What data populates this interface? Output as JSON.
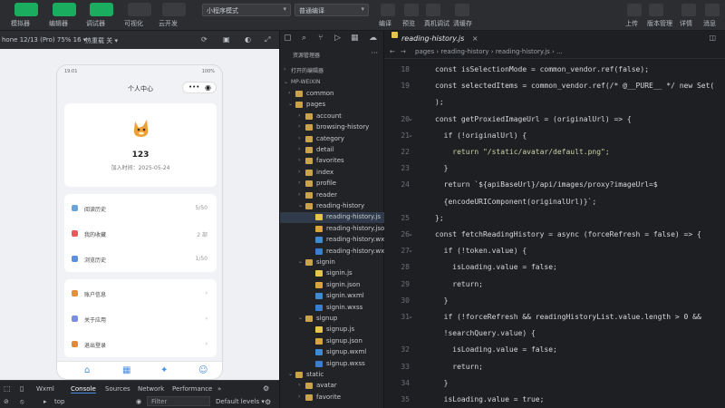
{
  "toolbar": {
    "left_buttons": [
      {
        "label": "模拟器"
      },
      {
        "label": "编辑器"
      },
      {
        "label": "调试器"
      },
      {
        "label": "可视化"
      },
      {
        "label": "云开发"
      }
    ],
    "mode_select": "小程序模式",
    "compile_select": "普通编译",
    "mid_buttons": [
      {
        "label": "编译"
      },
      {
        "label": "预览"
      },
      {
        "label": "真机调试"
      },
      {
        "label": "清缓存"
      }
    ],
    "right_buttons": [
      {
        "label": "上传"
      },
      {
        "label": "版本管理"
      },
      {
        "label": "详情"
      },
      {
        "label": "消息"
      }
    ]
  },
  "simulator": {
    "device": "hone 12/13 (Pro) 75% 16 ▾",
    "hot_reload": "热重载 关 ▾",
    "status_time": "19:01",
    "status_battery": "100%",
    "nav_title": "个人中心",
    "username": "123",
    "join_date": "加入时间：2025-05-24",
    "menu_group1": [
      {
        "label": "阅读历史",
        "count": "5/50",
        "color": "#6aa3d9"
      },
      {
        "label": "我的收藏",
        "count": "2 部",
        "color": "#e25b5b"
      },
      {
        "label": "浏览历史",
        "count": "1/50",
        "color": "#5b8fd9"
      }
    ],
    "menu_group2": [
      {
        "label": "账户信息",
        "color": "#e0913d"
      },
      {
        "label": "关于应用",
        "color": "#7a8ee0"
      },
      {
        "label": "退出登录",
        "color": "#e08a3d"
      }
    ],
    "tabbar_icons": [
      "home-icon",
      "grid-icon",
      "discover-icon",
      "user-icon"
    ]
  },
  "devtools": {
    "tabs": [
      "Wxml",
      "Console",
      "Sources",
      "Network",
      "Performance",
      "»"
    ],
    "active_tab": "Console",
    "context": "top",
    "filter_placeholder": "Filter",
    "levels": "Default levels ▾"
  },
  "explorer": {
    "title": "资源管理器",
    "open_editors": "打开的编辑器",
    "project": "MP-WEIXIN",
    "tree": [
      {
        "label": "common",
        "type": "folder",
        "depth": 1,
        "open": false
      },
      {
        "label": "pages",
        "type": "folder",
        "depth": 1,
        "open": true
      },
      {
        "label": "account",
        "type": "folder",
        "depth": 2,
        "open": false
      },
      {
        "label": "browsing-history",
        "type": "folder",
        "depth": 2,
        "open": false
      },
      {
        "label": "category",
        "type": "folder",
        "depth": 2,
        "open": false
      },
      {
        "label": "detail",
        "type": "folder",
        "depth": 2,
        "open": false
      },
      {
        "label": "favorites",
        "type": "folder",
        "depth": 2,
        "open": false
      },
      {
        "label": "index",
        "type": "folder",
        "depth": 2,
        "open": false
      },
      {
        "label": "profile",
        "type": "folder",
        "depth": 2,
        "open": false
      },
      {
        "label": "reader",
        "type": "folder",
        "depth": 2,
        "open": false
      },
      {
        "label": "reading-history",
        "type": "folder",
        "depth": 2,
        "open": true
      },
      {
        "label": "reading-history.js",
        "type": "js",
        "depth": 3,
        "selected": true
      },
      {
        "label": "reading-history.json",
        "type": "json",
        "depth": 3
      },
      {
        "label": "reading-history.wxml",
        "type": "wxml",
        "depth": 3
      },
      {
        "label": "reading-history.wxss",
        "type": "wxss",
        "depth": 3
      },
      {
        "label": "signin",
        "type": "folder",
        "depth": 2,
        "open": true
      },
      {
        "label": "signin.js",
        "type": "js",
        "depth": 3
      },
      {
        "label": "signin.json",
        "type": "json",
        "depth": 3
      },
      {
        "label": "signin.wxml",
        "type": "wxml",
        "depth": 3
      },
      {
        "label": "signin.wxss",
        "type": "wxss",
        "depth": 3
      },
      {
        "label": "signup",
        "type": "folder",
        "depth": 2,
        "open": true
      },
      {
        "label": "signup.js",
        "type": "js",
        "depth": 3
      },
      {
        "label": "signup.json",
        "type": "json",
        "depth": 3
      },
      {
        "label": "signup.wxml",
        "type": "wxml",
        "depth": 3
      },
      {
        "label": "signup.wxss",
        "type": "wxss",
        "depth": 3
      },
      {
        "label": "static",
        "type": "folder",
        "depth": 1,
        "open": true
      },
      {
        "label": "avatar",
        "type": "folder",
        "depth": 2,
        "open": false
      },
      {
        "label": "favorite",
        "type": "folder",
        "depth": 2,
        "open": false
      }
    ]
  },
  "editor": {
    "tab_label": "reading-history.js",
    "breadcrumb": "pages › reading-history › reading-history.js › ...",
    "lines": [
      {
        "n": "18",
        "text": "const isSelectionMode = common_vendor.ref(false);"
      },
      {
        "n": "19",
        "text": "const selectedItems = common_vendor.ref(/* @__PURE__ */ new Set("
      },
      {
        "n": "",
        "text": ");"
      },
      {
        "n": "20",
        "text": "const getProxiedImageUrl = (originalUrl) => {",
        "fold": true
      },
      {
        "n": "21",
        "text": "  if (!originalUrl) {",
        "fold": true
      },
      {
        "n": "22",
        "text": "    return \"/static/avatar/default.png\";"
      },
      {
        "n": "23",
        "text": "  }"
      },
      {
        "n": "24",
        "text": "  return `${apiBaseUrl}/api/images/proxy?imageUrl=$"
      },
      {
        "n": "",
        "text": "  {encodeURIComponent(originalUrl)}`;"
      },
      {
        "n": "25",
        "text": "};"
      },
      {
        "n": "26",
        "text": "const fetchReadingHistory = async (forceRefresh = false) => {",
        "fold": true
      },
      {
        "n": "27",
        "text": "  if (!token.value) {",
        "fold": true
      },
      {
        "n": "28",
        "text": "    isLoading.value = false;"
      },
      {
        "n": "29",
        "text": "    return;"
      },
      {
        "n": "30",
        "text": "  }"
      },
      {
        "n": "31",
        "text": "  if (!forceRefresh && readingHistoryList.value.length > 0 &&",
        "fold": true
      },
      {
        "n": "",
        "text": "  !searchQuery.value) {"
      },
      {
        "n": "32",
        "text": "    isLoading.value = false;"
      },
      {
        "n": "33",
        "text": "    return;"
      },
      {
        "n": "34",
        "text": "  }"
      },
      {
        "n": "35",
        "text": "  isLoading.value = true;"
      }
    ]
  }
}
